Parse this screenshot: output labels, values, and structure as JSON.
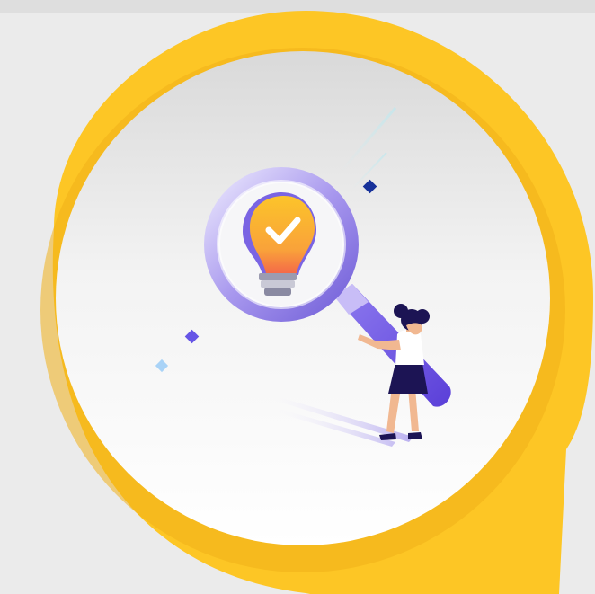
{
  "illustration": {
    "subject": "idea-search-illustration",
    "colors": {
      "background": "#ebebeb",
      "bubble_yellow": "#fdc625",
      "bubble_yellow_shadow": "#f3b31a",
      "inner_circle_top": "#dcdcdc",
      "inner_circle_bottom": "#ffffff",
      "lens_purple": "#9f8fe8",
      "handle_purple": "#6a4fe0",
      "bulb_yellow": "#fbbd2b",
      "bulb_orange": "#f57a3e",
      "figure_navy": "#1c1454",
      "accent_diamond_navy": "#17319a",
      "accent_diamond_violet": "#6655e6",
      "accent_diamond_light": "#a9d3f7"
    },
    "icons": [
      "magnifier-icon",
      "lightbulb-icon",
      "checkmark-icon",
      "diamond-icon"
    ]
  }
}
